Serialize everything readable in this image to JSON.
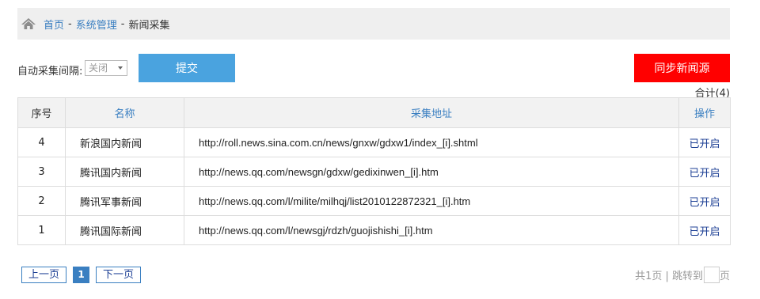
{
  "breadcrumb": {
    "home": "首页",
    "sep": "-",
    "section": "系统管理",
    "current": "新闻采集"
  },
  "toolbar": {
    "interval_label": "自动采集间隔:",
    "interval_value": "关闭",
    "submit_label": "提交",
    "sync_label": "同步新闻源"
  },
  "total": "合计(4)",
  "table": {
    "headers": [
      "序号",
      "名称",
      "采集地址",
      "操作"
    ],
    "rows": [
      {
        "seq": "4",
        "name": "新浪国内新闻",
        "url": "http://roll.news.sina.com.cn/news/gnxw/gdxw1/index_[i].shtml",
        "action": "已开启"
      },
      {
        "seq": "3",
        "name": "腾讯国内新闻",
        "url": "http://news.qq.com/newsgn/gdxw/gedixinwen_[i].htm",
        "action": "已开启"
      },
      {
        "seq": "2",
        "name": "腾讯军事新闻",
        "url": "http://news.qq.com/l/milite/milhqj/list2010122872321_[i].htm",
        "action": "已开启"
      },
      {
        "seq": "1",
        "name": "腾讯国际新闻",
        "url": "http://news.qq.com/l/newsgj/rdzh/guojishishi_[i].htm",
        "action": "已开启"
      }
    ]
  },
  "pager": {
    "prev": "上一页",
    "current": "1",
    "next": "下一页",
    "total_pages": "共1页 | 跳转到",
    "page_suffix": "页"
  },
  "colors": {
    "accent": "#3a7fc1",
    "submit": "#4aa3df",
    "sync": "#ff0000",
    "link": "#1c3f94"
  },
  "icons": {
    "home": "home-icon",
    "select_caret": "caret-down-icon"
  }
}
